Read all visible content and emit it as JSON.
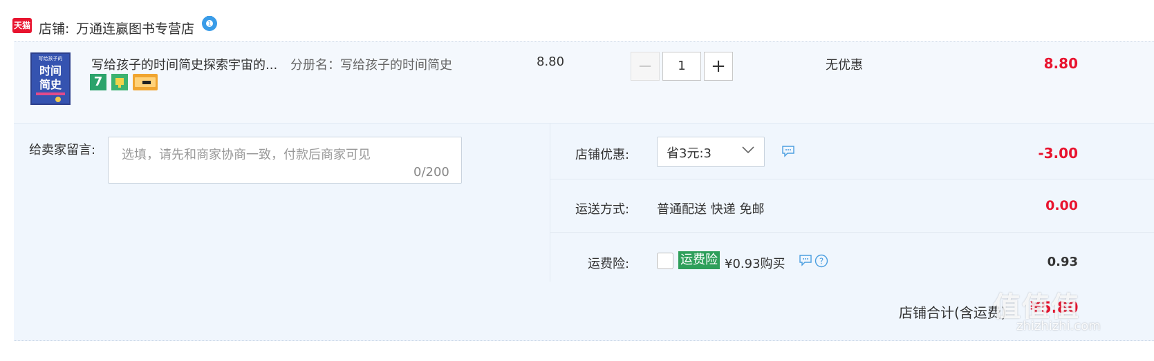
{
  "shop": {
    "logo_text": "天猫",
    "label": "店铺:",
    "name": "万通连赢图书专营店"
  },
  "item": {
    "cover_title": "时间简史",
    "cover_small": "写给孩子的",
    "title": "写给孩子的时间简史探索宇宙的...",
    "sku": "分册名：写给孩子的时间简史",
    "badges": [
      "7",
      "shield-icon",
      "card-icon"
    ],
    "price": "8.80",
    "quantity": "1",
    "qty_minus": "−",
    "qty_plus": "+",
    "discount": "无优惠",
    "subtotal": "8.80"
  },
  "message": {
    "label": "给卖家留言:",
    "placeholder": "选填，请先和商家协商一致，付款后商家可见",
    "count": "0/200"
  },
  "coupon": {
    "label": "店铺优惠:",
    "selected": "省3元:3",
    "amount": "-3.00"
  },
  "shipping": {
    "label": "运送方式:",
    "value": "普通配送 快递 免邮",
    "amount": "0.00"
  },
  "insurance": {
    "label": "运费险:",
    "badge": "运费险",
    "price": "¥0.93购买",
    "amount": "0.93",
    "help": "?"
  },
  "total": {
    "label": "店铺合计(含运费)",
    "value": "¥5.80"
  },
  "watermark": {
    "text": "值值值",
    "url": "zhizhizhi.com"
  },
  "colors": {
    "accent_red": "#e8142f",
    "insurance_green": "#2e9f5a",
    "panel_bg": "#f0f6fd"
  }
}
